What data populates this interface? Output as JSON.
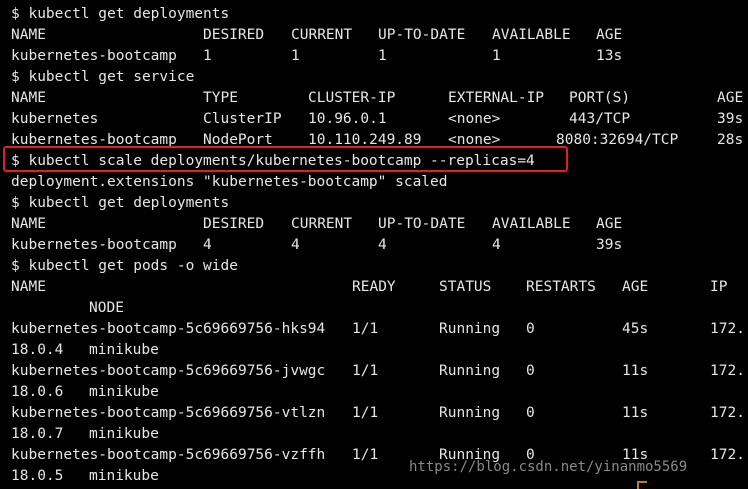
{
  "terminal": {
    "get_deployments_1": {
      "prompt": "$ kubectl get deployments",
      "headers": [
        "NAME",
        "DESIRED",
        "CURRENT",
        "UP-TO-DATE",
        "AVAILABLE",
        "AGE"
      ],
      "row": [
        "kubernetes-bootcamp",
        "1",
        "1",
        "1",
        "1",
        "13s"
      ]
    },
    "get_service": {
      "prompt": "$ kubectl get service",
      "headers": [
        "NAME",
        "TYPE",
        "CLUSTER-IP",
        "EXTERNAL-IP",
        "PORT(S)",
        "AGE"
      ],
      "rows": [
        [
          "kubernetes",
          "ClusterIP",
          "10.96.0.1",
          "<none>",
          "443/TCP",
          "39s"
        ],
        [
          "kubernetes-bootcamp",
          "NodePort",
          "10.110.249.89",
          "<none>",
          "8080:32694/TCP",
          "28s"
        ]
      ]
    },
    "scale": {
      "prompt": "$ kubectl scale deployments/kubernetes-bootcamp --replicas=4",
      "output": "deployment.extensions \"kubernetes-bootcamp\" scaled"
    },
    "get_deployments_2": {
      "prompt": "$ kubectl get deployments",
      "headers": [
        "NAME",
        "DESIRED",
        "CURRENT",
        "UP-TO-DATE",
        "AVAILABLE",
        "AGE"
      ],
      "row": [
        "kubernetes-bootcamp",
        "4",
        "4",
        "4",
        "4",
        "39s"
      ]
    },
    "get_pods": {
      "prompt": "$ kubectl get pods -o wide",
      "headers": [
        "NAME",
        "READY",
        "STATUS",
        "RESTARTS",
        "AGE",
        "IP"
      ],
      "header_wrap": "NODE",
      "rows": [
        {
          "name": "kubernetes-bootcamp-5c69669756-hks94",
          "ready": "1/1",
          "status": "Running",
          "restarts": "0",
          "age": "45s",
          "ip_start": "172.",
          "ip_end": "18.0.4",
          "node": "minikube"
        },
        {
          "name": "kubernetes-bootcamp-5c69669756-jvwgc",
          "ready": "1/1",
          "status": "Running",
          "restarts": "0",
          "age": "11s",
          "ip_start": "172.",
          "ip_end": "18.0.6",
          "node": "minikube"
        },
        {
          "name": "kubernetes-bootcamp-5c69669756-vtlzn",
          "ready": "1/1",
          "status": "Running",
          "restarts": "0",
          "age": "11s",
          "ip_start": "172.",
          "ip_end": "18.0.7",
          "node": "minikube"
        },
        {
          "name": "kubernetes-bootcamp-5c69669756-vzffh",
          "ready": "1/1",
          "status": "Running",
          "restarts": "0",
          "age": "11s",
          "ip_start": "172.",
          "ip_end": "18.0.5",
          "node": "minikube"
        }
      ]
    }
  },
  "watermark": "https://blog.csdn.net/yinanmo5569",
  "colors": {
    "background": "#000000",
    "text": "#e6e6e6",
    "highlight_border": "#e02020",
    "watermark": "#8a8a8a"
  }
}
